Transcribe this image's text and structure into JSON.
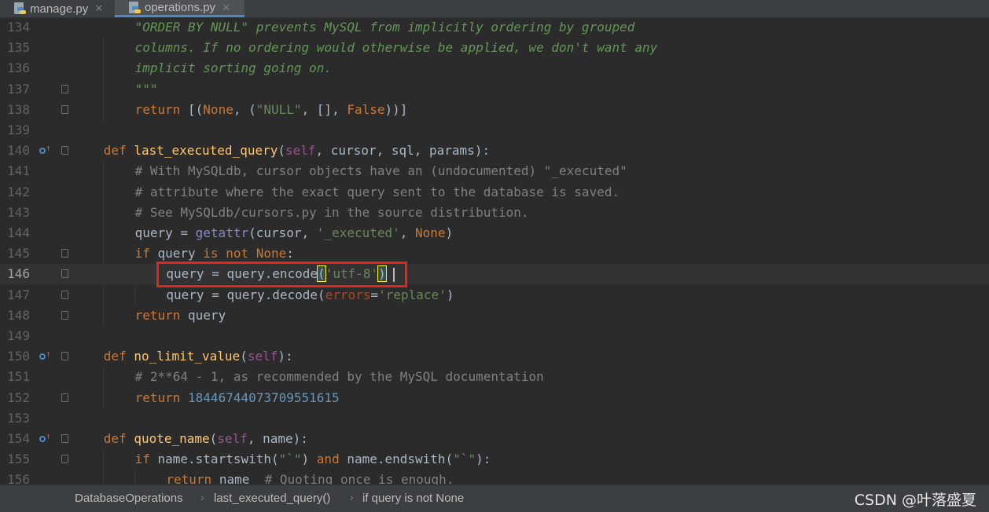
{
  "tabs": [
    {
      "label": "manage.py",
      "active": false
    },
    {
      "label": "operations.py",
      "active": true
    }
  ],
  "editor": {
    "current_line": 146,
    "lines": [
      {
        "n": 134,
        "tokens": [
          [
            "docstr",
            "\"ORDER BY NULL\" prevents MySQL from implicitly ordering by grouped"
          ]
        ]
      },
      {
        "n": 135,
        "tokens": [
          [
            "docstr",
            "columns. If no ordering would otherwise be applied, we don't want any"
          ]
        ]
      },
      {
        "n": 136,
        "tokens": [
          [
            "docstr",
            "implicit sorting going on."
          ]
        ]
      },
      {
        "n": 137,
        "tokens": [
          [
            "docstr",
            "\"\"\""
          ]
        ]
      },
      {
        "n": 138,
        "tokens": [
          [
            "kw",
            "return "
          ],
          [
            "plain",
            "[("
          ],
          [
            "kw",
            "None"
          ],
          [
            "plain",
            ", ("
          ],
          [
            "str",
            "\"NULL\""
          ],
          [
            "plain",
            ", [], "
          ],
          [
            "kw",
            "False"
          ],
          [
            "plain",
            "))]"
          ]
        ]
      },
      {
        "n": 139,
        "tokens": []
      },
      {
        "n": 140,
        "tokens": [
          [
            "kw",
            "def "
          ],
          [
            "fn",
            "last_executed_query"
          ],
          [
            "plain",
            "("
          ],
          [
            "self",
            "self"
          ],
          [
            "plain",
            ", cursor, sql, params):"
          ]
        ]
      },
      {
        "n": 141,
        "tokens": [
          [
            "com",
            "# With MySQLdb, cursor objects have an (undocumented) \"_executed\""
          ]
        ]
      },
      {
        "n": 142,
        "tokens": [
          [
            "com",
            "# attribute where the exact query sent to the database is saved."
          ]
        ]
      },
      {
        "n": 143,
        "tokens": [
          [
            "com",
            "# See MySQLdb/cursors.py in the source distribution."
          ]
        ]
      },
      {
        "n": 144,
        "tokens": [
          [
            "plain",
            "query = "
          ],
          [
            "bi",
            "getattr"
          ],
          [
            "plain",
            "(cursor, "
          ],
          [
            "str",
            "'_executed'"
          ],
          [
            "plain",
            ", "
          ],
          [
            "kw",
            "None"
          ],
          [
            "plain",
            ")"
          ]
        ]
      },
      {
        "n": 145,
        "tokens": [
          [
            "kw",
            "if "
          ],
          [
            "plain",
            "query "
          ],
          [
            "kw",
            "is not None"
          ],
          [
            "plain",
            ":"
          ]
        ]
      },
      {
        "n": 146,
        "tokens": [
          [
            "plain",
            "query = query.encode"
          ],
          [
            "brace",
            "("
          ],
          [
            "str",
            "'utf-8'"
          ],
          [
            "brace",
            ")"
          ]
        ]
      },
      {
        "n": 147,
        "tokens": [
          [
            "plain",
            "query = query.decode("
          ],
          [
            "kwarg",
            "errors"
          ],
          [
            "plain",
            "="
          ],
          [
            "str",
            "'replace'"
          ],
          [
            "plain",
            ")"
          ]
        ]
      },
      {
        "n": 148,
        "tokens": [
          [
            "kw",
            "return "
          ],
          [
            "plain",
            "query"
          ]
        ]
      },
      {
        "n": 149,
        "tokens": []
      },
      {
        "n": 150,
        "tokens": [
          [
            "kw",
            "def "
          ],
          [
            "fn",
            "no_limit_value"
          ],
          [
            "plain",
            "("
          ],
          [
            "self",
            "self"
          ],
          [
            "plain",
            "):"
          ]
        ]
      },
      {
        "n": 151,
        "tokens": [
          [
            "com",
            "# 2**64 - 1, as recommended by the MySQL documentation"
          ]
        ]
      },
      {
        "n": 152,
        "tokens": [
          [
            "kw",
            "return "
          ],
          [
            "num",
            "18446744073709551615"
          ]
        ]
      },
      {
        "n": 153,
        "tokens": []
      },
      {
        "n": 154,
        "tokens": [
          [
            "kw",
            "def "
          ],
          [
            "fn",
            "quote_name"
          ],
          [
            "plain",
            "("
          ],
          [
            "self",
            "self"
          ],
          [
            "plain",
            ", name):"
          ]
        ]
      },
      {
        "n": 155,
        "tokens": [
          [
            "kw",
            "if "
          ],
          [
            "plain",
            "name.startswith("
          ],
          [
            "str",
            "\"`\""
          ],
          [
            "plain",
            ") "
          ],
          [
            "kw",
            "and "
          ],
          [
            "plain",
            "name.endswith("
          ],
          [
            "str",
            "\"`\""
          ],
          [
            "plain",
            "):"
          ]
        ]
      },
      {
        "n": 156,
        "tokens": [
          [
            "kw",
            "return "
          ],
          [
            "plain",
            "name  "
          ],
          [
            "com",
            "# Quoting once is enough."
          ]
        ]
      }
    ]
  },
  "breadcrumb": [
    "DatabaseOperations",
    "last_executed_query()",
    "if query is not None"
  ],
  "watermark": "CSDN @叶落盛夏"
}
